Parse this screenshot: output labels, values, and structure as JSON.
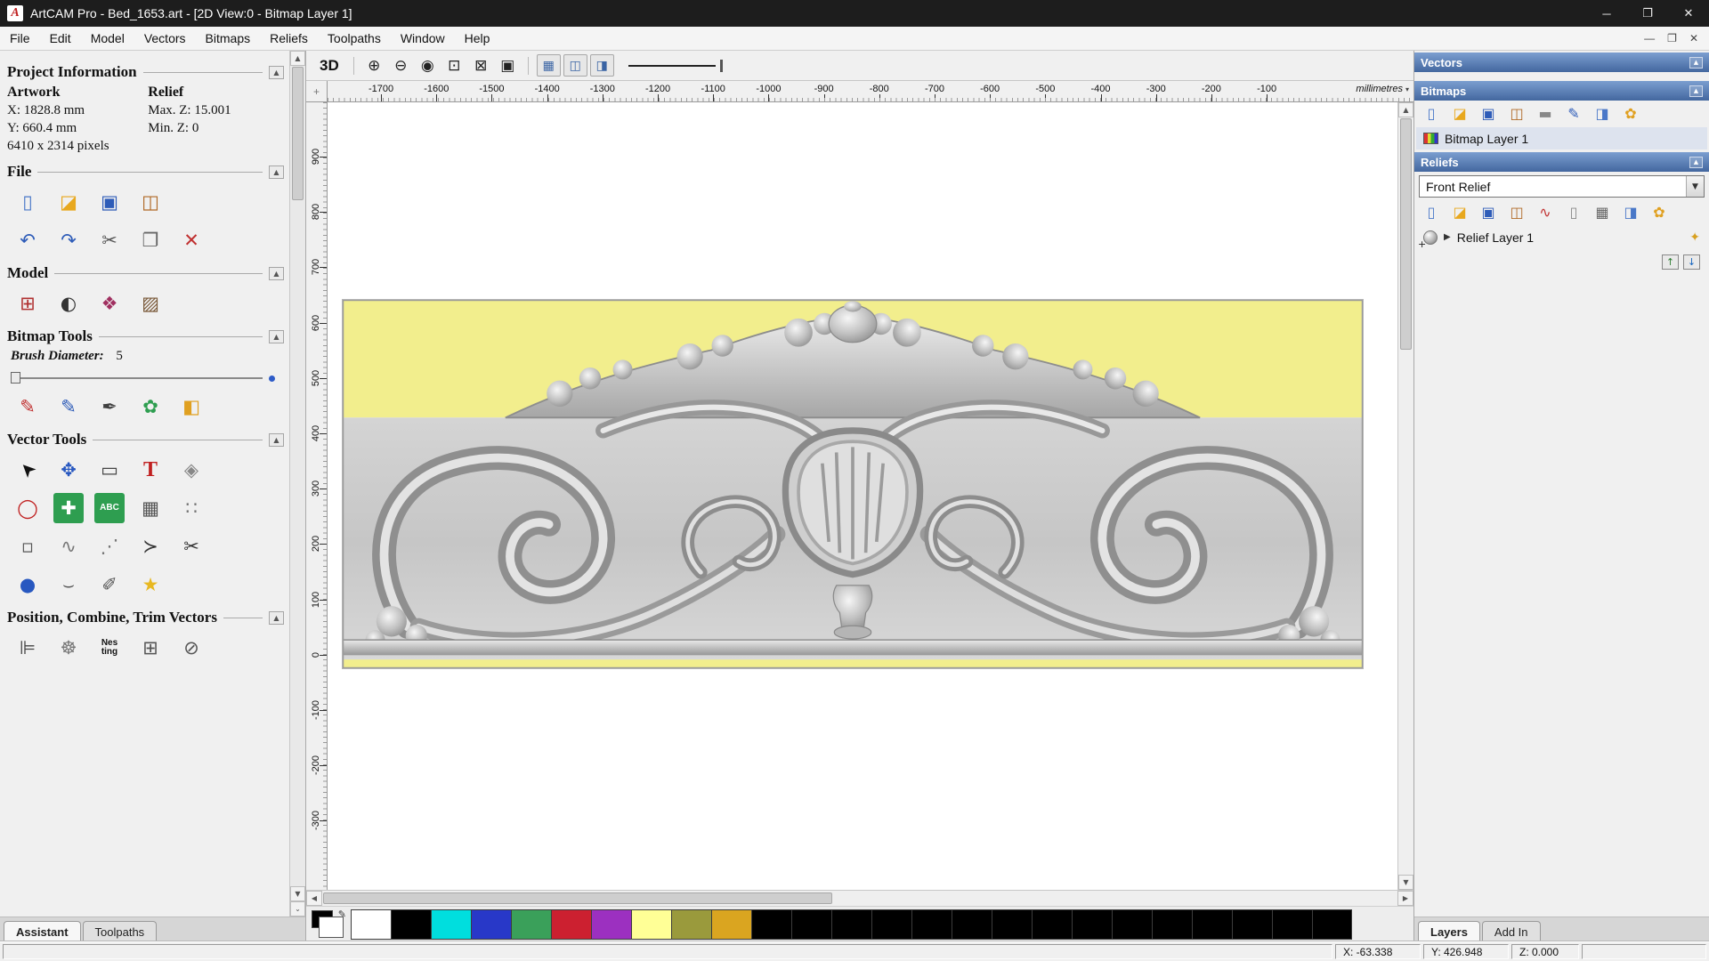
{
  "colors": {
    "titlebar-bg": "#1d1d1d",
    "accent-blue-light": "#7b9ed0",
    "accent-blue-dark": "#43679f",
    "panel-bg": "#f0f0f0",
    "canvas-bg": "#ffffff",
    "artwork-yellow": "#f2ee8d",
    "relief-gray": "#c9c9c9"
  },
  "titlebar": {
    "title": "ArtCAM Pro - Bed_1653.art - [2D View:0 - Bitmap Layer 1]",
    "minimize": "─",
    "maximize": "❐",
    "close": "✕"
  },
  "menubar": {
    "items": [
      {
        "name": "menu-file",
        "label": "File"
      },
      {
        "name": "menu-edit",
        "label": "Edit"
      },
      {
        "name": "menu-model",
        "label": "Model"
      },
      {
        "name": "menu-vectors",
        "label": "Vectors"
      },
      {
        "name": "menu-bitmaps",
        "label": "Bitmaps"
      },
      {
        "name": "menu-reliefs",
        "label": "Reliefs"
      },
      {
        "name": "menu-toolpaths",
        "label": "Toolpaths"
      },
      {
        "name": "menu-window",
        "label": "Window"
      },
      {
        "name": "menu-help",
        "label": "Help"
      }
    ],
    "child_minimize": "—",
    "child_restore": "❐",
    "child_close": "✕"
  },
  "assistant": {
    "project_information": {
      "title": "Project Information",
      "artwork_heading": "Artwork",
      "relief_heading": "Relief",
      "artwork_x": "X: 1828.8 mm",
      "artwork_y": "Y: 660.4 mm",
      "relief_max_z": "Max. Z: 15.001",
      "relief_min_z": "Min. Z: 0",
      "pixels": "6410 x 2314 pixels"
    },
    "file_section": {
      "title": "File",
      "icons_row1": [
        {
          "name": "new-model-icon",
          "glyph": "▯",
          "color": "#4a78c8"
        },
        {
          "name": "open-model-icon",
          "glyph": "◪",
          "color": "#e8a81e"
        },
        {
          "name": "save-model-icon",
          "glyph": "▣",
          "color": "#2e5cb8"
        },
        {
          "name": "export-model-icon",
          "glyph": "◫",
          "color": "#b06a28"
        }
      ],
      "icons_row2": [
        {
          "name": "undo-icon",
          "glyph": "↶",
          "color": "#2e5cb8"
        },
        {
          "name": "redo-icon",
          "glyph": "↷",
          "color": "#2e5cb8"
        },
        {
          "name": "cut-icon",
          "glyph": "✂",
          "color": "#555555"
        },
        {
          "name": "paste-icon",
          "glyph": "❐",
          "color": "#666666"
        },
        {
          "name": "delete-icon",
          "glyph": "✕",
          "color": "#c03030"
        }
      ]
    },
    "model_section": {
      "title": "Model",
      "icons": [
        {
          "name": "set-model-size-icon",
          "glyph": "⊞",
          "color": "#b03030"
        },
        {
          "name": "model-lighting-icon",
          "glyph": "◐",
          "color": "#333333"
        },
        {
          "name": "adjust-model-icon",
          "glyph": "❖",
          "color": "#a03060"
        },
        {
          "name": "greyscale-view-icon",
          "glyph": "▨",
          "color": "#7a5a3a"
        }
      ]
    },
    "bitmap_tools": {
      "title": "Bitmap Tools",
      "brush_label": "Brush Diameter:",
      "brush_value": "5",
      "icons": [
        {
          "name": "paint-icon",
          "glyph": "✎",
          "color": "#c03030"
        },
        {
          "name": "paint-selective-icon",
          "glyph": "✎",
          "color": "#2e5cb8"
        },
        {
          "name": "draw-icon",
          "glyph": "✒",
          "color": "#404040"
        },
        {
          "name": "colour-palette-icon",
          "glyph": "✿",
          "color": "#2e9e50"
        },
        {
          "name": "flood-fill-icon",
          "glyph": "◧",
          "color": "#e0a020"
        }
      ]
    },
    "vector_tools": {
      "title": "Vector Tools",
      "row1": [
        {
          "name": "select-vectors-icon",
          "glyph": "➤",
          "color": "#111111",
          "cls": "rot-nw"
        },
        {
          "name": "transform-vectors-icon",
          "glyph": "✥",
          "color": "#2858c0"
        },
        {
          "name": "create-rectangle-icon",
          "glyph": "▭",
          "color": "#444444"
        },
        {
          "name": "create-text-icon",
          "glyph": "T",
          "color": "#c02020",
          "cls": "bold-serif"
        },
        {
          "name": "mirror-vectors-icon",
          "glyph": "◈",
          "color": "#888888"
        }
      ],
      "row2": [
        {
          "name": "create-ellipse-icon",
          "glyph": "◯",
          "color": "#c02020"
        },
        {
          "name": "block-paste-icon",
          "glyph": "✚",
          "color": "#ffffff",
          "bg": "#2e9e50"
        },
        {
          "name": "convert-text-icon",
          "glyph": "ABC",
          "color": "#ffffff",
          "bg": "#2e9e50",
          "cls": "txt-icon"
        },
        {
          "name": "envelope-distort-icon",
          "glyph": "▦",
          "color": "#555555"
        },
        {
          "name": "create-polygon-icon",
          "glyph": "∷",
          "color": "#777777"
        }
      ],
      "row3": [
        {
          "name": "node-edit-icon",
          "glyph": "▫",
          "color": "#555555"
        },
        {
          "name": "create-freehand-icon",
          "glyph": "∿",
          "color": "#777777"
        },
        {
          "name": "fit-curve-icon",
          "glyph": "⋰",
          "color": "#777777"
        },
        {
          "name": "create-polyline-icon",
          "glyph": "≻",
          "color": "#333333"
        },
        {
          "name": "snip-vector-icon",
          "glyph": "✂",
          "color": "#333333"
        }
      ],
      "row4": [
        {
          "name": "wrap-cylinder-icon",
          "glyph": "●",
          "color": "#2858c0"
        },
        {
          "name": "create-arc-icon",
          "glyph": "⌣",
          "color": "#555555"
        },
        {
          "name": "measure-tool-icon",
          "glyph": "✐",
          "color": "#555555"
        },
        {
          "name": "create-star-icon",
          "glyph": "★",
          "color": "#e8b820"
        }
      ]
    },
    "position_section": {
      "title": "Position, Combine, Trim Vectors",
      "icons": [
        {
          "name": "align-vectors-icon",
          "glyph": "⊫",
          "color": "#444444"
        },
        {
          "name": "rotate-copy-vectors-icon",
          "glyph": "☸",
          "color": "#777777"
        },
        {
          "name": "nesting-icon",
          "glyph": "Nes ting",
          "color": "#111111",
          "cls": "txt-icon"
        },
        {
          "name": "block-copy-icon",
          "glyph": "⊞",
          "color": "#555555"
        },
        {
          "name": "weld-vectors-icon",
          "glyph": "⊘",
          "color": "#555555"
        }
      ]
    },
    "tabs": [
      {
        "name": "tab-assistant",
        "label": "Assistant",
        "active": true
      },
      {
        "name": "tab-toolpaths",
        "label": "Toolpaths",
        "active": false
      }
    ]
  },
  "canvas": {
    "toolbar": {
      "view_toggle": "3D",
      "zoom_tools": [
        {
          "name": "zoom-in-icon",
          "glyph": "⊕",
          "color": "#222222"
        },
        {
          "name": "zoom-out-icon",
          "glyph": "⊖",
          "color": "#222222"
        },
        {
          "name": "zoom-previous-icon",
          "glyph": "◉",
          "color": "#222222"
        },
        {
          "name": "zoom-window-icon",
          "glyph": "⊡",
          "color": "#222222"
        },
        {
          "name": "zoom-fit-icon",
          "glyph": "⊠",
          "color": "#222222"
        },
        {
          "name": "zoom-100-icon",
          "glyph": "▣",
          "color": "#222222"
        }
      ],
      "toggles": [
        {
          "name": "toggle-grid-snap-icon",
          "glyph": "▦",
          "color": "#3a64a4"
        },
        {
          "name": "toggle-guide-snap-icon",
          "glyph": "◫",
          "color": "#3a64a4"
        },
        {
          "name": "toggle-object-snap-icon",
          "glyph": "◨",
          "color": "#3a64a4"
        }
      ]
    },
    "hruler": {
      "labels": [
        "-1700",
        "-1600",
        "-1500",
        "-1400",
        "-1300",
        "-1200",
        "-1100",
        "-1000",
        "-900",
        "-800",
        "-700",
        "-600",
        "-500",
        "-400",
        "-300",
        "-200",
        "-100"
      ],
      "unit": "millimetres"
    },
    "vruler": {
      "labels": [
        "900",
        "800",
        "700",
        "600",
        "500",
        "400",
        "300",
        "200",
        "100",
        "0",
        "-100",
        "-200",
        "-300"
      ]
    }
  },
  "layers_panel": {
    "vectors": {
      "title": "Vectors"
    },
    "bitmaps": {
      "title": "Bitmaps",
      "tools": [
        {
          "name": "new-bitmap-layer-icon",
          "glyph": "▯",
          "color": "#4a78c8"
        },
        {
          "name": "open-bitmap-layer-icon",
          "glyph": "◪",
          "color": "#e8a81e"
        },
        {
          "name": "save-bitmap-layer-icon",
          "glyph": "▣",
          "color": "#2e5cb8"
        },
        {
          "name": "import-bitmap-icon",
          "glyph": "◫",
          "color": "#b06a28"
        },
        {
          "name": "paint-roller-icon",
          "glyph": "▬",
          "color": "#888888"
        },
        {
          "name": "text-edit-layer-icon",
          "glyph": "✎",
          "color": "#2e5cb8"
        },
        {
          "name": "delete-bitmap-layer-icon",
          "glyph": "◨",
          "color": "#4a78c8"
        },
        {
          "name": "bitmap-palette-icon",
          "glyph": "✿",
          "color": "#e0a020"
        }
      ],
      "layers": [
        {
          "name": "Bitmap Layer 1"
        }
      ]
    },
    "reliefs": {
      "title": "Reliefs",
      "active_relief": "Front Relief",
      "tools": [
        {
          "name": "new-relief-layer-icon",
          "glyph": "▯",
          "color": "#4a78c8"
        },
        {
          "name": "open-relief-layer-icon",
          "glyph": "◪",
          "color": "#e8a81e"
        },
        {
          "name": "save-relief-layer-icon",
          "glyph": "▣",
          "color": "#2e5cb8"
        },
        {
          "name": "import-relief-icon",
          "glyph": "◫",
          "color": "#b06a28"
        },
        {
          "name": "smooth-relief-icon",
          "glyph": "∿",
          "color": "#c03030"
        },
        {
          "name": "relief-page-icon",
          "glyph": "▯",
          "color": "#888888"
        },
        {
          "name": "calculate-relief-icon",
          "glyph": "▦",
          "color": "#666666"
        },
        {
          "name": "delete-relief-layer-icon",
          "glyph": "◨",
          "color": "#4a78c8"
        },
        {
          "name": "relief-palette-icon",
          "glyph": "✿",
          "color": "#e0a020"
        }
      ],
      "layers": [
        {
          "name": "Relief Layer 1"
        }
      ],
      "move_up": "↑",
      "move_down": "↓"
    },
    "tabs": [
      {
        "name": "tab-layers",
        "label": "Layers",
        "active": true
      },
      {
        "name": "tab-add-in",
        "label": "Add In",
        "active": false
      }
    ]
  },
  "palette": {
    "swatches": [
      "#ffffff",
      "#000000",
      "#00dede",
      "#2838c8",
      "#3aa05a",
      "#cc2030",
      "#9c30c0",
      "#ffff96",
      "#9a9a3c",
      "#daa520",
      "#000000",
      "#000000",
      "#000000",
      "#000000",
      "#000000",
      "#000000",
      "#000000",
      "#000000",
      "#000000",
      "#000000",
      "#000000",
      "#000000",
      "#000000",
      "#000000",
      "#000000"
    ]
  },
  "statusbar": {
    "x": "X: -63.338",
    "y": "Y: 426.948",
    "z": "Z: 0.000"
  }
}
